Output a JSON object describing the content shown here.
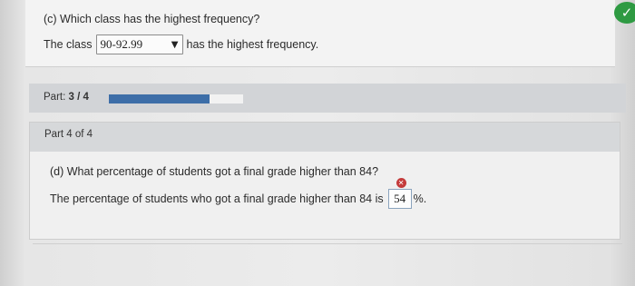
{
  "part_c": {
    "question": "(c) Which class has the highest frequency?",
    "prefix": "The class",
    "selected": "90-92.99",
    "suffix": "has the highest frequency.",
    "caret": "▼",
    "status_icon": "check-icon",
    "status_color": "#2e9a42"
  },
  "progress": {
    "label_prefix": "Part:",
    "label_value": "3 / 4",
    "fraction": 0.75,
    "fill_color": "#3d6ea8"
  },
  "part_d": {
    "header": "Part 4 of 4",
    "question": "(d) What percentage of students got a final grade higher than 84?",
    "answer_prefix": "The percentage of students who got a final grade higher than 84 is",
    "answer_value": "54",
    "answer_suffix": "%.",
    "status_icon": "error-x-icon",
    "status_color": "#c43b3b"
  }
}
